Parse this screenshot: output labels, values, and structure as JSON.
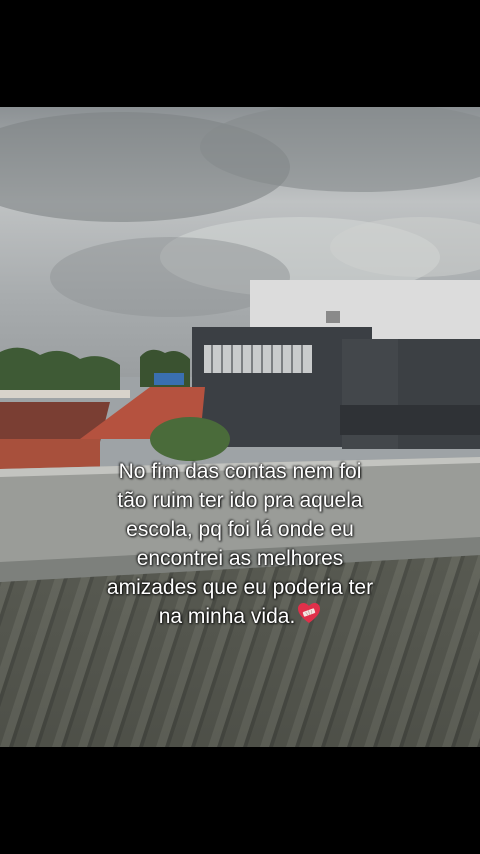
{
  "caption": {
    "lines": [
      "No fim das contas nem foi",
      "tão ruim ter ido pra aquela",
      "escola, pq foi lá onde eu",
      "encontrei as melhores",
      "amizades que eu poderia ter",
      "na minha vida."
    ],
    "emoji": "mending-heart-icon"
  },
  "colors": {
    "background": "#000000",
    "sky": "#b4b8ba",
    "text": "#ffffff",
    "heart": "#e0304a"
  }
}
